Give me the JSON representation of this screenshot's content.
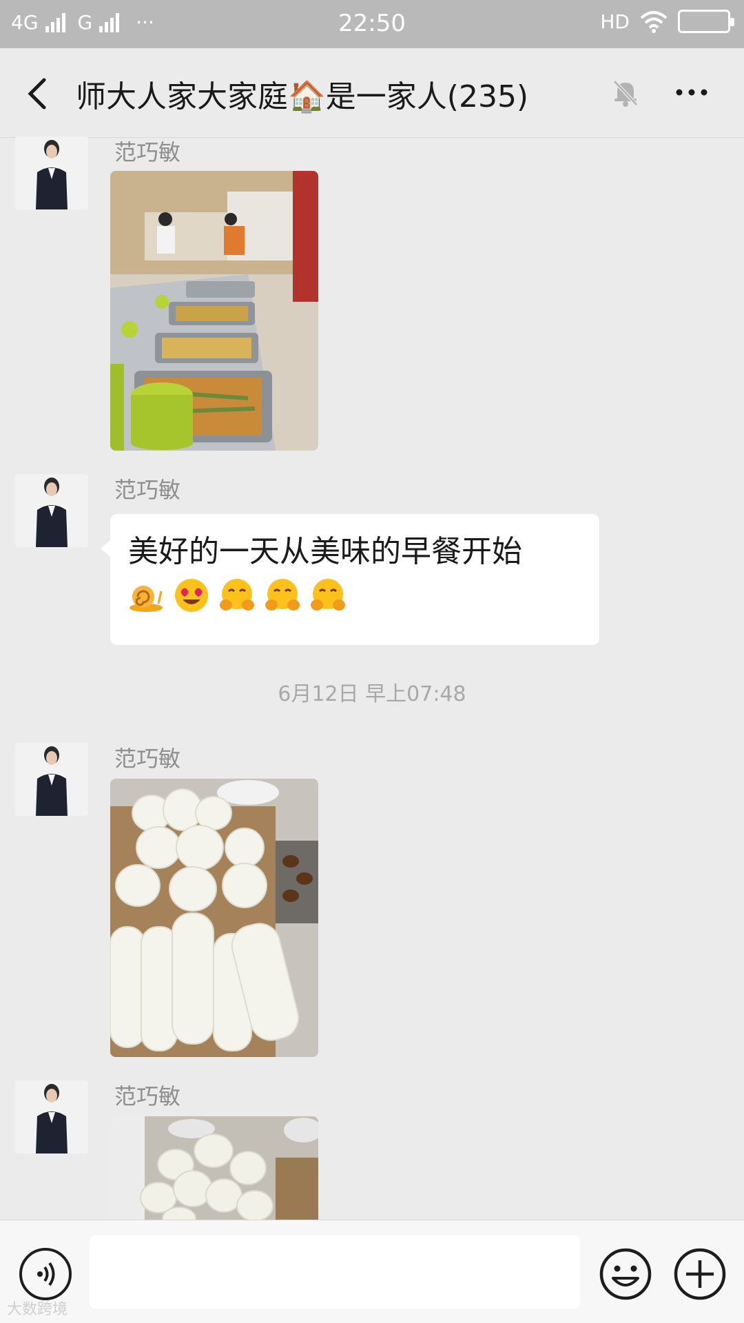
{
  "status_bar": {
    "network_1": "4G",
    "network_2": "G",
    "overflow": "···",
    "time": "22:50",
    "hd": "HD",
    "icons": [
      "signal-icon",
      "wifi-icon",
      "battery-icon"
    ]
  },
  "header": {
    "title": "师大人家大家庭🏠是一家人(235)",
    "icons": [
      "back-icon",
      "mute-bell-icon",
      "more-icon"
    ]
  },
  "messages": [
    {
      "sender": "范巧敏",
      "type": "image",
      "image_desc": "cafeteria-buffet-photo"
    },
    {
      "sender": "范巧敏",
      "type": "text",
      "text": "美好的一天从美味的早餐开始",
      "emojis": [
        "snail",
        "heart-eyes",
        "hugging",
        "hugging",
        "hugging"
      ]
    },
    {
      "sender": "范巧敏",
      "type": "image",
      "image_desc": "steamed-buns-photo"
    },
    {
      "sender": "范巧敏",
      "type": "image",
      "image_desc": "baozi-tray-photo"
    }
  ],
  "timestamp": "6月12日 早上07:48",
  "input_bar": {
    "icons": [
      "voice-icon",
      "emoji-icon",
      "plus-icon"
    ]
  },
  "watermark": "大数跨境",
  "colors": {
    "background": "#ebebeb",
    "status_bar": "#b9b9b9",
    "sender_gray": "#8e8e8e"
  }
}
